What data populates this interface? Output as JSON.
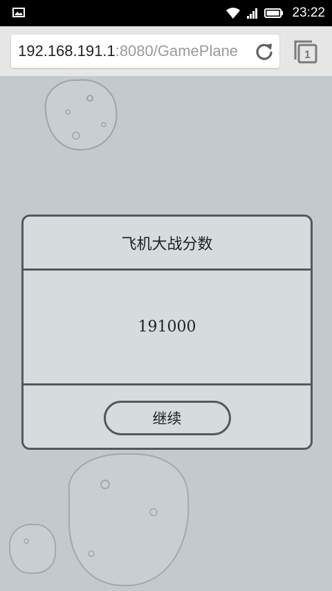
{
  "status_bar": {
    "time": "23:22",
    "icons": [
      "gallery-icon",
      "wifi-icon",
      "signal-icon",
      "battery-icon"
    ]
  },
  "browser": {
    "url_host": "192.168.191.1",
    "url_path": ":8080/GamePlane",
    "tab_count": "1",
    "icons": [
      "reload-icon",
      "tabs-icon"
    ]
  },
  "dialog": {
    "title": "飞机大战分数",
    "score": "191000",
    "continue_label": "继续"
  },
  "colors": {
    "background": "#c4c9cd",
    "dialog_bg": "#d6dbde",
    "border": "#55585a"
  }
}
